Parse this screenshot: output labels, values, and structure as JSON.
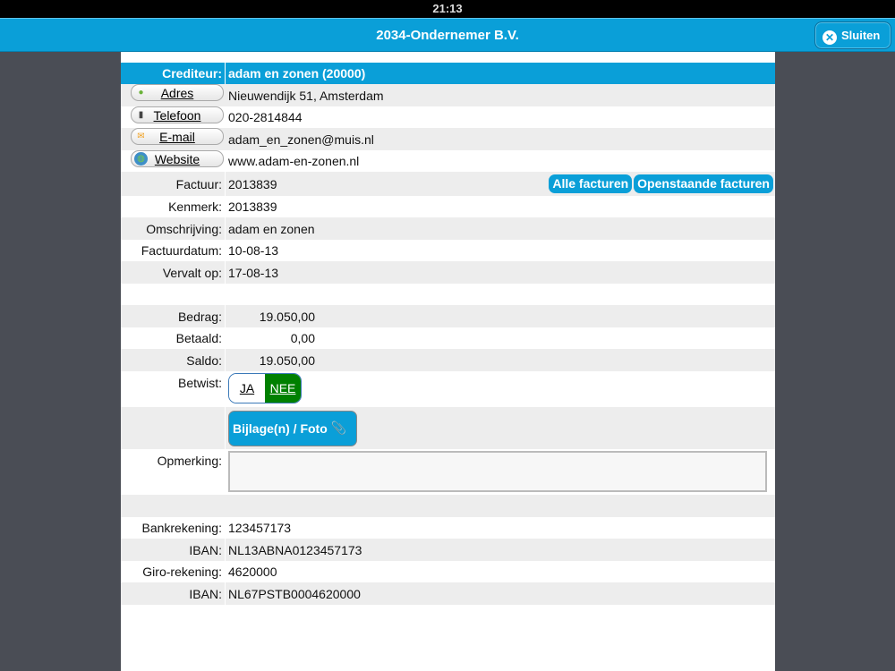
{
  "status_bar": {
    "time": "21:13"
  },
  "header": {
    "title": "2034-Ondernemer B.V.",
    "close_label": "Sluiten"
  },
  "crediteur": {
    "label": "Crediteur:",
    "value": "adam en zonen (20000)"
  },
  "contact": [
    {
      "label": "Adres",
      "value": "Nieuwendijk 51, Amsterdam",
      "icon": "map-pin-icon"
    },
    {
      "label": "Telefoon",
      "value": "020-2814844",
      "icon": "phone-icon"
    },
    {
      "label": "E-mail",
      "value": "adam_en_zonen@muis.nl",
      "icon": "mail-icon"
    },
    {
      "label": "Website",
      "value": "www.adam-en-zonen.nl",
      "icon": "globe-icon"
    }
  ],
  "invoice": {
    "factuur": {
      "label": "Factuur:",
      "value": "2013839"
    },
    "all_invoices_label": "Alle facturen",
    "open_invoices_label": "Openstaande facturen",
    "kenmerk": {
      "label": "Kenmerk:",
      "value": "2013839"
    },
    "omschrijving": {
      "label": "Omschrijving:",
      "value": "adam en zonen"
    },
    "factuurdatum": {
      "label": "Factuurdatum:",
      "value": "10-08-13"
    },
    "vervalt": {
      "label": "Vervalt op:",
      "value": "17-08-13"
    }
  },
  "amounts": {
    "bedrag": {
      "label": "Bedrag:",
      "value": "19.050,00"
    },
    "betaald": {
      "label": "Betaald:",
      "value": "0,00"
    },
    "saldo": {
      "label": "Saldo:",
      "value": "19.050,00"
    }
  },
  "betwist": {
    "label": "Betwist:",
    "yes": "JA",
    "no": "NEE",
    "selected": "NEE",
    "selected_color": "#008000"
  },
  "attachment_label": "Bijlage(n) / Foto",
  "opmerking": {
    "label": "Opmerking:",
    "value": ""
  },
  "bank": [
    {
      "label": "Bankrekening:",
      "value": "123457173"
    },
    {
      "label": "IBAN:",
      "value": "NL13ABNA0123457173"
    },
    {
      "label": "Giro-rekening:",
      "value": "4620000"
    },
    {
      "label": "IBAN:",
      "value": "NL67PSTB0004620000"
    }
  ]
}
